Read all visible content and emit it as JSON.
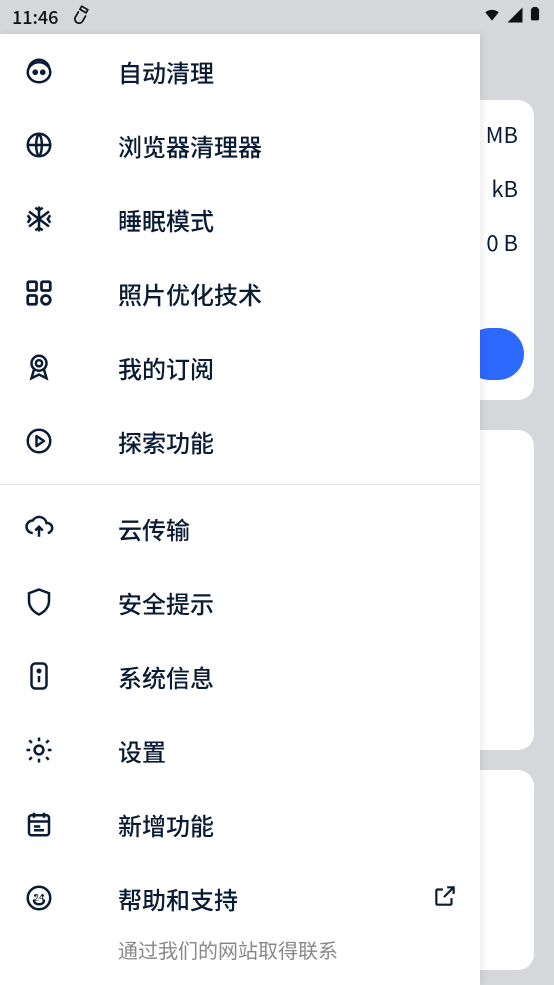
{
  "status": {
    "time": "11:46"
  },
  "background": {
    "line1": "MB",
    "line2": "kB",
    "line3": "0 B"
  },
  "menu": {
    "section1": [
      {
        "icon": "robot-icon",
        "label": "自动清理"
      },
      {
        "icon": "globe-icon",
        "label": "浏览器清理器"
      },
      {
        "icon": "snowflake-icon",
        "label": "睡眠模式"
      },
      {
        "icon": "grid-icon",
        "label": "照片优化技术"
      },
      {
        "icon": "badge-icon",
        "label": "我的订阅"
      },
      {
        "icon": "play-circle-icon",
        "label": "探索功能"
      }
    ],
    "section2": [
      {
        "icon": "cloud-upload-icon",
        "label": "云传输"
      },
      {
        "icon": "shield-icon",
        "label": "安全提示"
      },
      {
        "icon": "info-device-icon",
        "label": "系统信息"
      },
      {
        "icon": "gear-icon",
        "label": "设置"
      },
      {
        "icon": "calendar-icon",
        "label": "新增功能"
      },
      {
        "icon": "support-icon",
        "label": "帮助和支持",
        "trailing": "external-link-icon"
      }
    ],
    "footer": "通过我们的网站取得联系"
  }
}
